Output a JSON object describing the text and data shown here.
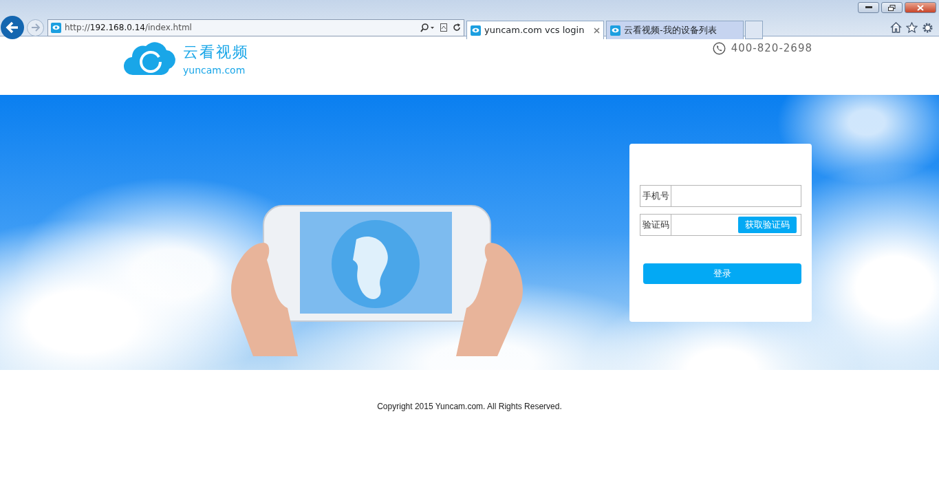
{
  "browser": {
    "address_prefix": "http://",
    "address_host": "192.168.0.14",
    "address_path": "/index.html",
    "tabs": [
      {
        "label": "yuncam.com vcs login",
        "selected": true,
        "closable": true
      },
      {
        "label": "云看视频-我的设备列表",
        "selected": false,
        "closable": false
      }
    ]
  },
  "header": {
    "logo_title": "云看视频",
    "logo_subtitle": "yuncam.com",
    "phone": "400-820-2698"
  },
  "login": {
    "fields": [
      {
        "kind": "text",
        "label": "手机号"
      },
      {
        "kind": "code",
        "label": "验证码",
        "button": "获取验证码"
      }
    ],
    "submit": "登录"
  },
  "footer": {
    "copyright": "Copyright 2015 Yuncam.com. All Rights Reserved."
  }
}
